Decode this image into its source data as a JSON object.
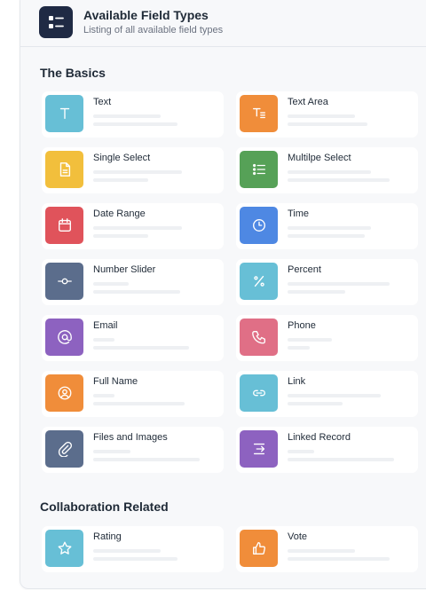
{
  "header": {
    "title": "Available Field Types",
    "subtitle": "Listing of all available field types",
    "icon": "list-icon",
    "badge_color": "#1f2a44"
  },
  "sections": [
    {
      "title": "The Basics",
      "items": [
        {
          "label": "Text",
          "icon": "text-icon",
          "color": "#67bfd6"
        },
        {
          "label": "Text Area",
          "icon": "text-area-icon",
          "color": "#f08d3a"
        },
        {
          "label": "Single Select",
          "icon": "document-icon",
          "color": "#f2bf3c"
        },
        {
          "label": "Multilpe Select",
          "icon": "list-icon",
          "color": "#56a157"
        },
        {
          "label": "Date Range",
          "icon": "calendar-icon",
          "color": "#e0535b"
        },
        {
          "label": "Time",
          "icon": "clock-icon",
          "color": "#4e88e3"
        },
        {
          "label": "Number Slider",
          "icon": "slider-icon",
          "color": "#5b6d8c"
        },
        {
          "label": "Percent",
          "icon": "percent-icon",
          "color": "#67bfd6"
        },
        {
          "label": "Email",
          "icon": "at-icon",
          "color": "#8d62c0"
        },
        {
          "label": "Phone",
          "icon": "phone-icon",
          "color": "#e06f86"
        },
        {
          "label": "Full Name",
          "icon": "user-circle-icon",
          "color": "#f08d3a"
        },
        {
          "label": "Link",
          "icon": "link-icon",
          "color": "#67bfd6"
        },
        {
          "label": "Files and Images",
          "icon": "paperclip-icon",
          "color": "#5b6d8c"
        },
        {
          "label": "Linked Record",
          "icon": "linked-record-icon",
          "color": "#8d62c0"
        }
      ]
    },
    {
      "title": "Collaboration Related",
      "items": [
        {
          "label": "Rating",
          "icon": "star-icon",
          "color": "#67bfd6"
        },
        {
          "label": "Vote",
          "icon": "thumb-icon",
          "color": "#f08d3a"
        }
      ]
    }
  ]
}
